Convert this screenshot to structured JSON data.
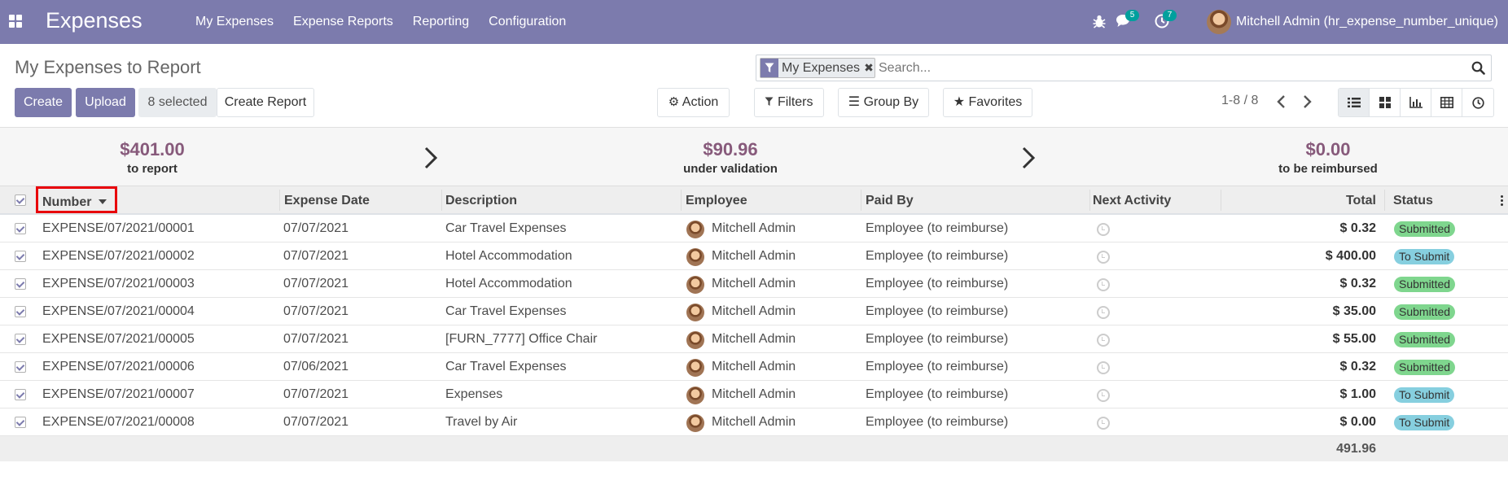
{
  "app": {
    "title": "Expenses",
    "menu": [
      "My Expenses",
      "Expense Reports",
      "Reporting",
      "Configuration"
    ],
    "messages_count": "5",
    "activities_count": "7",
    "user_name": "Mitchell Admin (hr_expense_number_unique)"
  },
  "control_panel": {
    "breadcrumb": "My Expenses to Report",
    "create_label": "Create",
    "upload_label": "Upload",
    "selected_label": "8 selected",
    "create_report_label": "Create Report",
    "action_label": "Action",
    "filters_label": "Filters",
    "group_by_label": "Group By",
    "favorites_label": "Favorites",
    "facet_label": "My Expenses",
    "search_placeholder": "Search...",
    "pager": "1-8 / 8"
  },
  "summary": [
    {
      "amount": "$401.00",
      "label": "to report"
    },
    {
      "amount": "$90.96",
      "label": "under validation"
    },
    {
      "amount": "$0.00",
      "label": "to be reimbursed"
    }
  ],
  "table": {
    "columns": [
      "Number",
      "Expense Date",
      "Description",
      "Employee",
      "Paid By",
      "Next Activity",
      "Total",
      "Status"
    ],
    "rows": [
      {
        "number": "EXPENSE/07/2021/00001",
        "date": "07/07/2021",
        "description": "Car Travel Expenses",
        "employee": "Mitchell Admin",
        "paid_by": "Employee (to reimburse)",
        "total": "$ 0.32",
        "status": "Submitted"
      },
      {
        "number": "EXPENSE/07/2021/00002",
        "date": "07/07/2021",
        "description": "Hotel Accommodation",
        "employee": "Mitchell Admin",
        "paid_by": "Employee (to reimburse)",
        "total": "$ 400.00",
        "status": "To Submit"
      },
      {
        "number": "EXPENSE/07/2021/00003",
        "date": "07/07/2021",
        "description": "Hotel Accommodation",
        "employee": "Mitchell Admin",
        "paid_by": "Employee (to reimburse)",
        "total": "$ 0.32",
        "status": "Submitted"
      },
      {
        "number": "EXPENSE/07/2021/00004",
        "date": "07/07/2021",
        "description": "Car Travel Expenses",
        "employee": "Mitchell Admin",
        "paid_by": "Employee (to reimburse)",
        "total": "$ 35.00",
        "status": "Submitted"
      },
      {
        "number": "EXPENSE/07/2021/00005",
        "date": "07/07/2021",
        "description": "[FURN_7777] Office Chair",
        "employee": "Mitchell Admin",
        "paid_by": "Employee (to reimburse)",
        "total": "$ 55.00",
        "status": "Submitted"
      },
      {
        "number": "EXPENSE/07/2021/00006",
        "date": "07/06/2021",
        "description": "Car Travel Expenses",
        "employee": "Mitchell Admin",
        "paid_by": "Employee (to reimburse)",
        "total": "$ 0.32",
        "status": "Submitted"
      },
      {
        "number": "EXPENSE/07/2021/00007",
        "date": "07/07/2021",
        "description": "Expenses",
        "employee": "Mitchell Admin",
        "paid_by": "Employee (to reimburse)",
        "total": "$ 1.00",
        "status": "To Submit"
      },
      {
        "number": "EXPENSE/07/2021/00008",
        "date": "07/07/2021",
        "description": "Travel by Air",
        "employee": "Mitchell Admin",
        "paid_by": "Employee (to reimburse)",
        "total": "$ 0.00",
        "status": "To Submit"
      }
    ],
    "grand_total": "491.96"
  },
  "colors": {
    "brand": "#7c7bad",
    "amount": "#875a7b",
    "status_submitted": "#7fd68e",
    "status_to_submit": "#86cfdf",
    "highlight": "#e8000b"
  }
}
